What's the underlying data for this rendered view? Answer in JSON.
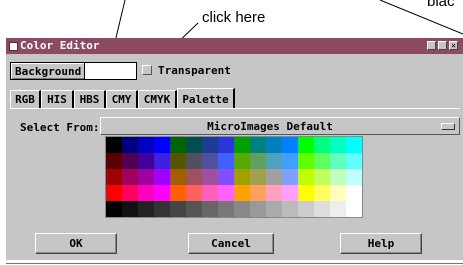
{
  "annotations": {
    "click_here": "click here",
    "black": "blac"
  },
  "window": {
    "title": "Color Editor",
    "title_buttons": [
      "minimize-icon",
      "maximize-icon",
      "close-icon"
    ]
  },
  "top_row": {
    "background_label": "Background",
    "transparent_label": "Transparent",
    "swatch_color": "#ffffff"
  },
  "tabs": [
    {
      "label": "RGB"
    },
    {
      "label": "HIS"
    },
    {
      "label": "HBS"
    },
    {
      "label": "CMY"
    },
    {
      "label": "CMYK"
    },
    {
      "label": "Palette",
      "active": true
    }
  ],
  "palette_panel": {
    "select_label": "Select From:",
    "select_value": "MicroImages Default"
  },
  "palette_grid": {
    "rows": [
      [
        "#000000",
        "#000080",
        "#0000c0",
        "#0000ff",
        "#006400",
        "#004f4f",
        "#1e3c96",
        "#2a37d8",
        "#00a000",
        "#008080",
        "#0080c0",
        "#0080ff",
        "#00ff00",
        "#00ff80",
        "#00ffc0",
        "#00ffff"
      ],
      [
        "#5a0000",
        "#500050",
        "#4000a0",
        "#4020e0",
        "#555500",
        "#505060",
        "#5050a0",
        "#4060ff",
        "#55aa00",
        "#60a060",
        "#50a0c0",
        "#40a0ff",
        "#60ff00",
        "#60ff60",
        "#60ffc0",
        "#60ffff"
      ],
      [
        "#a00000",
        "#a00060",
        "#a000a0",
        "#a000ff",
        "#a06000",
        "#a05060",
        "#a050a0",
        "#8050ff",
        "#a0a000",
        "#a0a050",
        "#a0a0a0",
        "#80a0ff",
        "#c0ff00",
        "#c0ff60",
        "#c0ffc0",
        "#c0ffff"
      ],
      [
        "#ff0000",
        "#ff0060",
        "#ff00c0",
        "#ff00ff",
        "#ff6000",
        "#ff6060",
        "#ff60c0",
        "#ff60ff",
        "#ffa000",
        "#ffa060",
        "#ffa0c0",
        "#ffa0ff",
        "#ffff00",
        "#ffff60",
        "#ffffc0",
        "#ffffff"
      ],
      [
        "#000000",
        "#111111",
        "#222222",
        "#333333",
        "#444444",
        "#555555",
        "#666666",
        "#777777",
        "#888888",
        "#999999",
        "#aaaaaa",
        "#bbbbbb",
        "#cccccc",
        "#dddddd",
        "#eeeeee",
        "#ffffff"
      ]
    ]
  },
  "buttons": {
    "ok": "OK",
    "cancel": "Cancel",
    "help": "Help"
  }
}
